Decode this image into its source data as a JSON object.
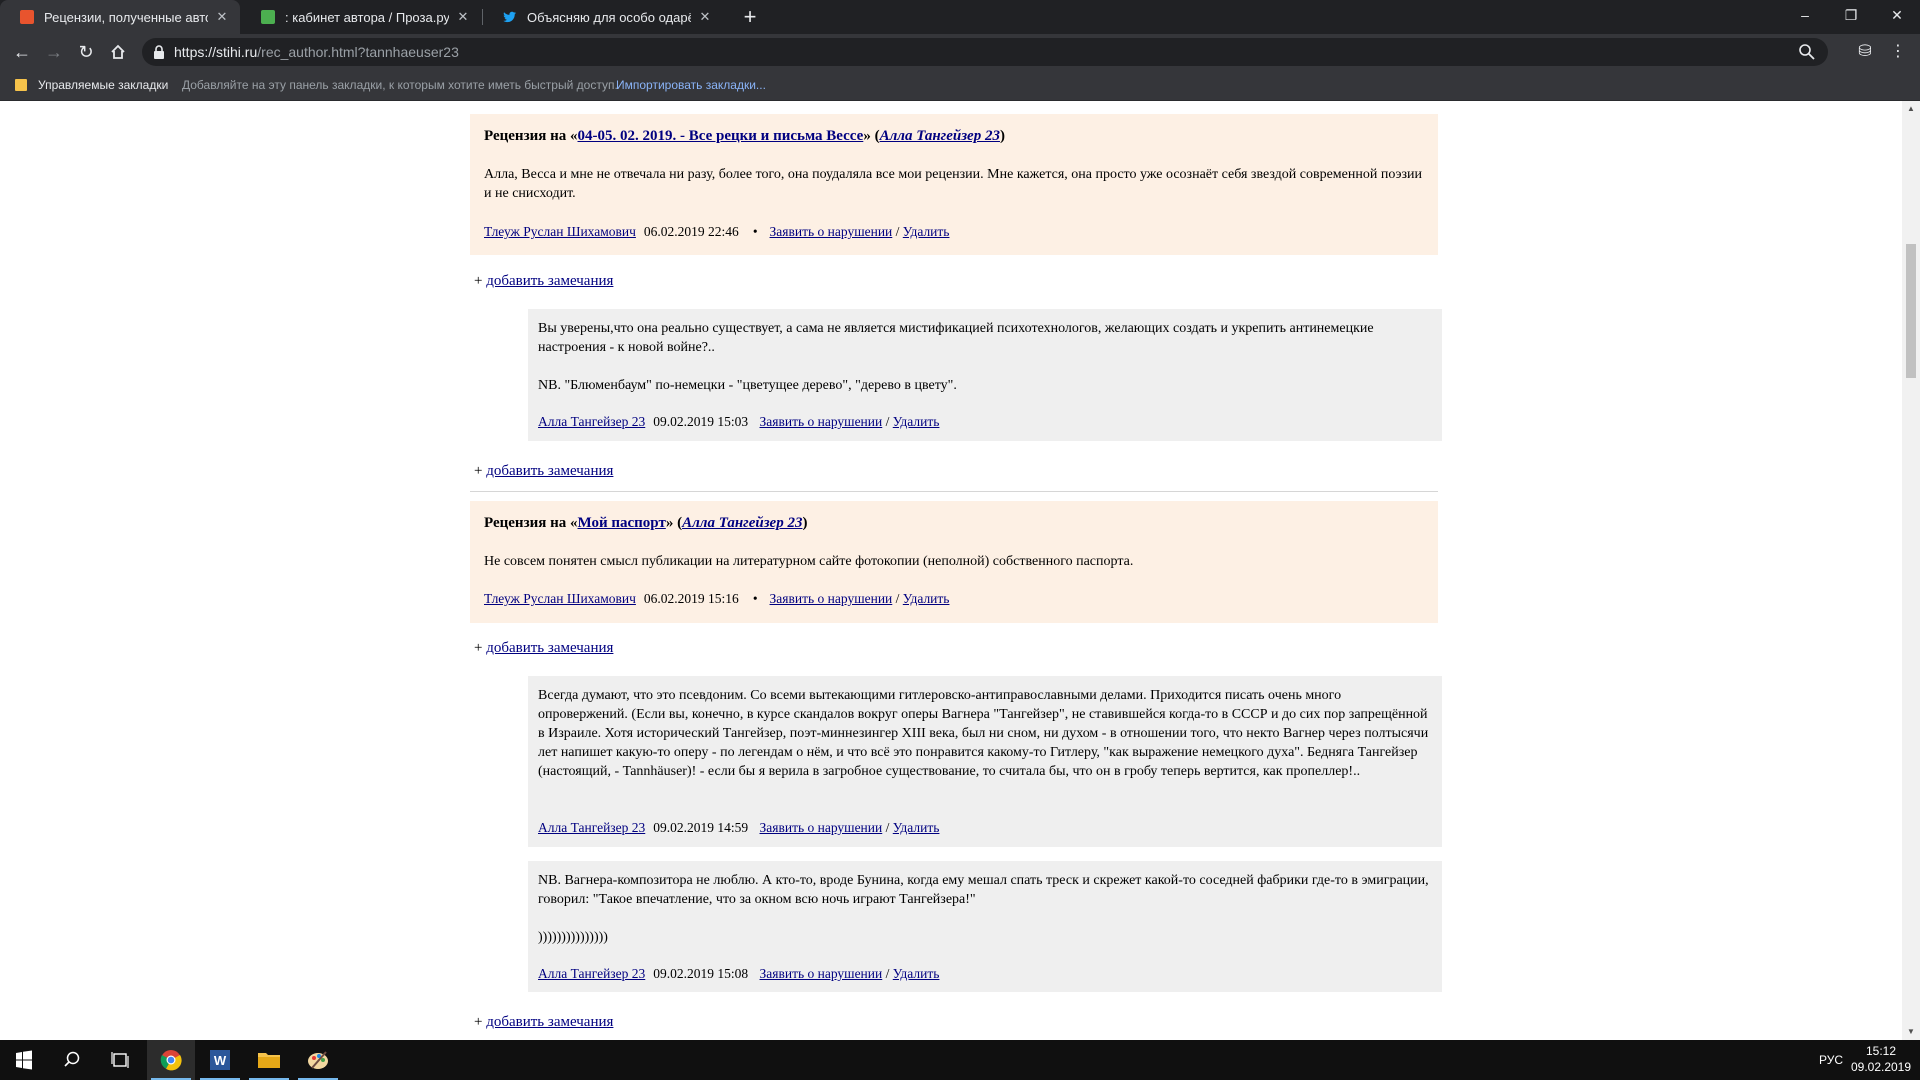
{
  "browser": {
    "tabs": [
      {
        "title": "Рецензии, полученные автором",
        "active": true,
        "favicon_color": "#e8542e"
      },
      {
        "title": ": кабинет автора / Проза.ру",
        "active": false,
        "favicon_color": "#4caf50"
      },
      {
        "title": "Объясняю для особо одарённых",
        "active": false,
        "favicon_color": "#1da1f2"
      }
    ],
    "new_tab_icon": "plus-icon",
    "url_host": "https://stihi.ru",
    "url_path": "/rec_author.html?tannhaeuser23",
    "bookmarks_folder": "Управляемые закладки",
    "bookmarks_hint": "Добавляйте на эту панель закладки, к которым хотите иметь быстрый доступ.",
    "bookmarks_import": "Импортировать закладки..."
  },
  "labels": {
    "review_prefix": "Рецензия на «",
    "review_mid": "» (",
    "review_suffix": ")",
    "report": "Заявить о нарушении",
    "slash": "/",
    "delete": "Удалить",
    "bullet": "•",
    "add_note": "добавить замечания",
    "add_plus": "+"
  },
  "reviews": [
    {
      "work": "04-05. 02. 2019. - Все рецки и письма Вессе",
      "work_author": "Алла Тангейзер 23",
      "text": "Алла, Весса и мне не отвечала ни разу, более того, она поудаляла все мои рецензии. Мне кажется, она просто уже осознаёт себя звездой современной поэзии и не снисходит.",
      "reviewer": "Тлеуж Руслан Шихамович",
      "date": "06.02.2019 22:46",
      "replies": [
        {
          "text": "Вы уверены,что она реально существует, а сама не является мистификацией психотехнологов, желающих создать и укрепить антинемецкие настроения - к новой войне?..",
          "text2": "NB. \"Блюменбаум\" по-немецки - \"цветущее дерево\", \"дерево в цвету\".",
          "author": "Алла Тангейзер 23",
          "date": "09.02.2019 15:03"
        }
      ]
    },
    {
      "work": "Мой паспорт",
      "work_author": "Алла Тангейзер 23",
      "text": "Не совсем понятен смысл публикации на литературном сайте фотокопии (неполной) собственного паспорта.",
      "reviewer": "Тлеуж Руслан Шихамович",
      "date": "06.02.2019 15:16",
      "replies": [
        {
          "text": "Всегда думают, что это псевдоним. Со всеми вытекающими гитлеровско-антиправославными делами. Приходится писать очень много опровержений. (Если вы, конечно, в курсе скандалов вокруг оперы Вагнера \"Тангейзер\", не ставившейся когда-то в СССР и до сих пор запрещённой в Израиле. Хотя исторический Тангейзер, поэт-миннезингер XIII века, был ни сном, ни духом - в отношении того, что некто Вагнер через полтысячи лет напишет какую-то оперу - по легендам о нём, и что всё это понравится какому-то Гитлеру, \"как выражение немецкого духа\". Бедняга Тангейзер (настоящий, - Tannhäuser)! - если бы я верила в загробное существование, то считала бы, что он в гробу теперь вертится, как пропеллер!..",
          "author": "Алла Тангейзер 23",
          "date": "09.02.2019 14:59"
        },
        {
          "text": "NB. Вагнера-композитора не люблю. А кто-то, вроде Бунина, когда ему мешал спать треск и скрежет какой-то соседней фабрики где-то в эмиграции, говорил: \"Такое впечатление, что за окном всю ночь играют Тангейзера!\"",
          "text2": ")))))))))))))))",
          "author": "Алла Тангейзер 23",
          "date": "09.02.2019 15:08"
        }
      ]
    }
  ],
  "taskbar": {
    "apps": [
      "windows-start-icon",
      "search-icon",
      "task-view-icon",
      "chrome-icon",
      "word-icon",
      "file-explorer-icon",
      "paint-icon"
    ],
    "language": "РУС",
    "time": "15:12",
    "date": "09.02.2019"
  },
  "colors": {
    "review_bg": "#fdf0e4",
    "reply_bg": "#efefef",
    "link": "#000080"
  }
}
